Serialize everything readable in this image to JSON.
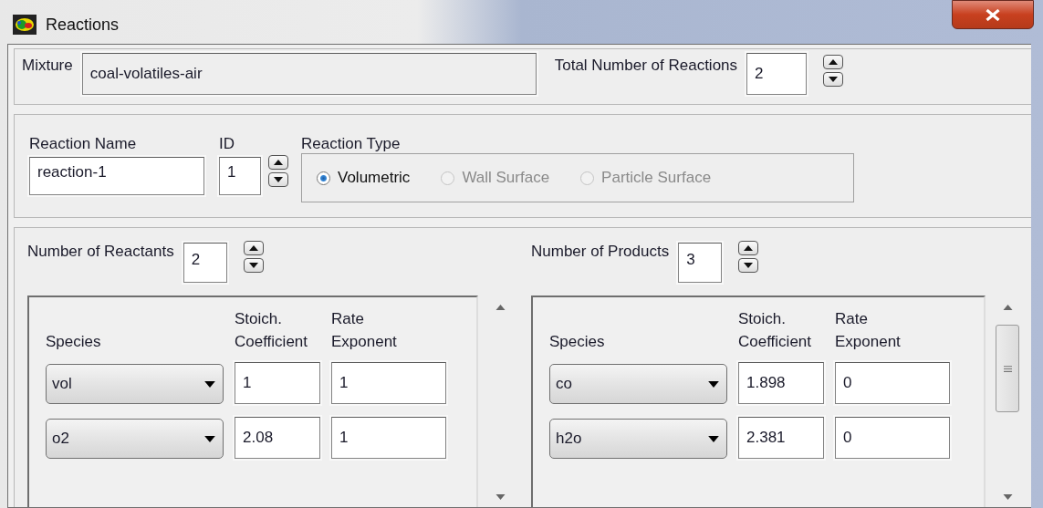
{
  "window": {
    "title": "Reactions"
  },
  "mixture": {
    "label": "Mixture",
    "value": "coal-volatiles-air"
  },
  "total_reactions": {
    "label": "Total Number of Reactions",
    "value": "2"
  },
  "reaction": {
    "name_label": "Reaction Name",
    "name": "reaction-1",
    "id_label": "ID",
    "id": "1",
    "type_label": "Reaction Type",
    "types": [
      {
        "label": "Volumetric",
        "selected": true,
        "disabled": false
      },
      {
        "label": "Wall Surface",
        "selected": false,
        "disabled": true
      },
      {
        "label": "Particle Surface",
        "selected": false,
        "disabled": true
      }
    ]
  },
  "sides": [
    {
      "count_label": "Number of Reactants",
      "count": "2",
      "columns": [
        "Species",
        "Stoich.\nCoefficient",
        "Rate\nExponent"
      ],
      "rows": [
        {
          "species": "vol",
          "coefficient": "1",
          "exponent": "1"
        },
        {
          "species": "o2",
          "coefficient": "2.08",
          "exponent": "1"
        }
      ]
    },
    {
      "count_label": "Number of Products",
      "count": "3",
      "columns": [
        "Species",
        "Stoich.\nCoefficient",
        "Rate\nExponent"
      ],
      "rows": [
        {
          "species": "co",
          "coefficient": "1.898",
          "exponent": "0"
        },
        {
          "species": "h2o",
          "coefficient": "2.381",
          "exponent": "0"
        }
      ]
    }
  ]
}
